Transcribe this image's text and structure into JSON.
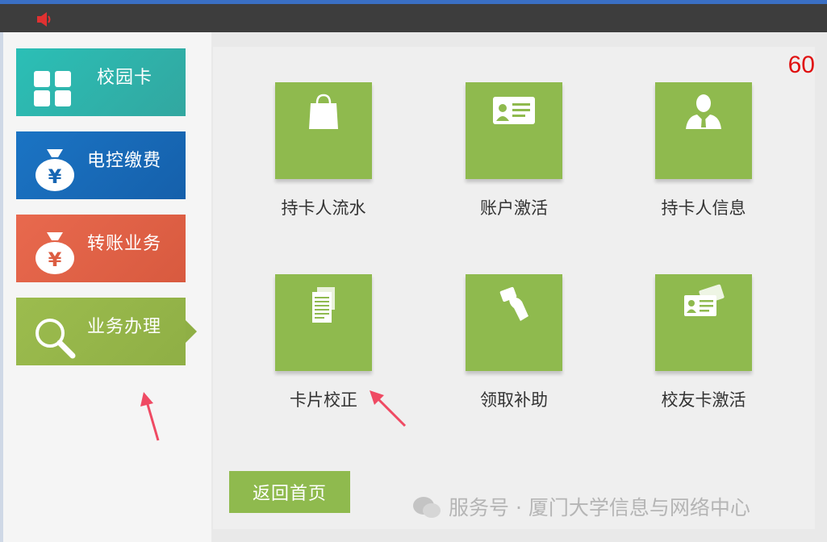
{
  "colors": {
    "topbar": "#3d3d3d",
    "accent_green": "#8fba4e",
    "campus_teal": "#2bbfb6",
    "power_blue": "#1b74c4",
    "transfer_red": "#e8694e",
    "countdown_red": "#e01010"
  },
  "topbar": {
    "icon": "speaker-icon"
  },
  "sidebar": {
    "items": [
      {
        "label": "校园卡",
        "icon": "grid-icon"
      },
      {
        "label": "电控缴费",
        "icon": "money-bag-icon"
      },
      {
        "label": "转账业务",
        "icon": "money-bag-icon"
      },
      {
        "label": "业务办理",
        "icon": "magnifier-icon",
        "active": true
      }
    ]
  },
  "main": {
    "countdown": "60",
    "tiles": [
      {
        "label": "持卡人流水",
        "icon": "shopping-bag-icon"
      },
      {
        "label": "账户激活",
        "icon": "id-card-icon"
      },
      {
        "label": "持卡人信息",
        "icon": "person-icon"
      },
      {
        "label": "卡片校正",
        "icon": "document-icon"
      },
      {
        "label": "领取补助",
        "icon": "hand-card-icon"
      },
      {
        "label": "校友卡激活",
        "icon": "cards-icon"
      }
    ],
    "home_button": "返回首页",
    "watermark": "服务号 · 厦门大学信息与网络中心"
  }
}
